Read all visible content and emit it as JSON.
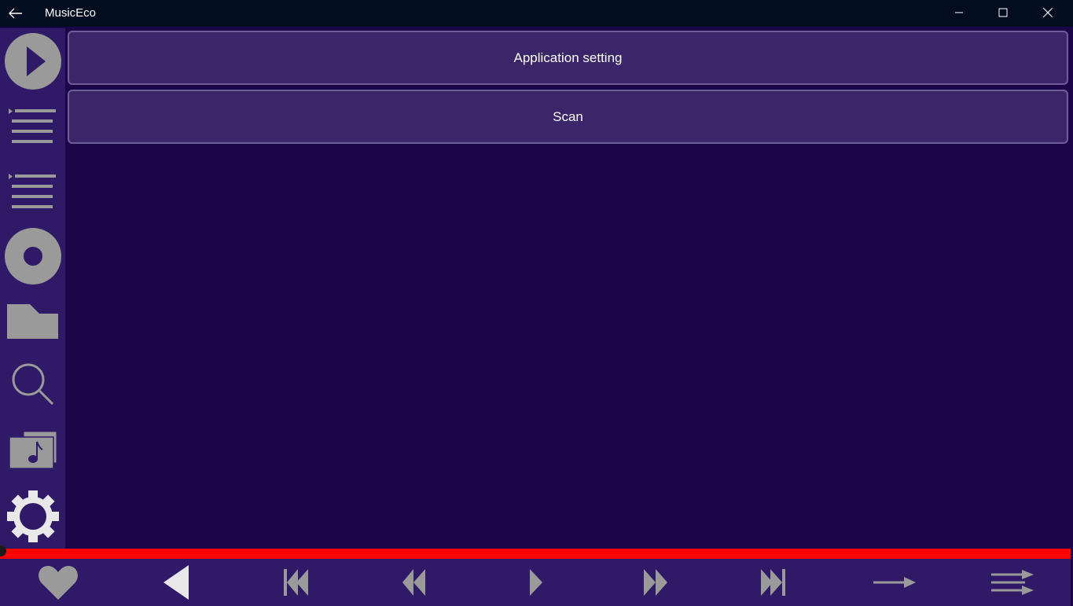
{
  "window": {
    "title": "MusicEco",
    "back_icon": "back-arrow-icon",
    "controls": [
      "minimize-icon",
      "maximize-icon",
      "close-icon"
    ]
  },
  "sidebar": {
    "items": [
      {
        "name": "now-playing",
        "icon": "play-circle-icon"
      },
      {
        "name": "playlist",
        "icon": "playlist-icon"
      },
      {
        "name": "queue",
        "icon": "queue-list-icon"
      },
      {
        "name": "albums",
        "icon": "disc-icon"
      },
      {
        "name": "folders",
        "icon": "folder-icon"
      },
      {
        "name": "search",
        "icon": "search-icon"
      },
      {
        "name": "library",
        "icon": "music-library-icon"
      },
      {
        "name": "settings",
        "icon": "gear-icon"
      }
    ]
  },
  "main": {
    "buttons": [
      {
        "label": "Application setting"
      },
      {
        "label": "Scan"
      }
    ]
  },
  "player": {
    "progress": 1.0,
    "controls": [
      {
        "name": "favorite",
        "icon": "heart-icon"
      },
      {
        "name": "volume",
        "icon": "speaker-icon"
      },
      {
        "name": "previous-track",
        "icon": "skip-back-icon"
      },
      {
        "name": "rewind",
        "icon": "rewind-icon"
      },
      {
        "name": "play",
        "icon": "play-icon"
      },
      {
        "name": "fast-forward",
        "icon": "fast-forward-icon"
      },
      {
        "name": "next-track",
        "icon": "skip-forward-icon"
      },
      {
        "name": "repeat-mode",
        "icon": "arrow-right-icon"
      },
      {
        "name": "shuffle-mode",
        "icon": "shuffle-arrows-icon"
      }
    ]
  },
  "colors": {
    "titlebar": "#030d20",
    "sidebar": "#2e1a66",
    "main_bg": "#1a0749",
    "button_bg": "#3a2668",
    "progress": "#ff0000",
    "icon": "#9a9a9a"
  }
}
